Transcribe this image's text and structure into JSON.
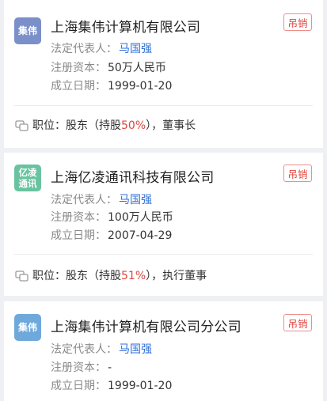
{
  "companies": [
    {
      "logo_text": "集伟",
      "logo_color": "#7b8fc9",
      "name": "上海集伟计算机有限公司",
      "status": "吊销",
      "legal_rep_label": "法定代表人：",
      "legal_rep": "马国强",
      "capital_label": "注册资本：",
      "capital": "50万人民币",
      "founded_label": "成立日期：",
      "founded": "1999-01-20",
      "position_label": "职位：",
      "position_pre": "股东（持股",
      "position_pct": "50%",
      "position_post": "），董事长"
    },
    {
      "logo_text": "亿凌通讯",
      "logo_color": "#69c3a0",
      "name": "上海亿凌通讯科技有限公司",
      "status": "吊销",
      "legal_rep_label": "法定代表人：",
      "legal_rep": "马国强",
      "capital_label": "注册资本：",
      "capital": "100万人民币",
      "founded_label": "成立日期：",
      "founded": "2007-04-29",
      "position_label": "职位：",
      "position_pre": "股东（持股",
      "position_pct": "51%",
      "position_post": "），执行董事"
    },
    {
      "logo_text": "集伟",
      "logo_color": "#6fa9dc",
      "name": "上海集伟计算机有限公司分公司",
      "status": "吊销",
      "legal_rep_label": "法定代表人：",
      "legal_rep": "马国强",
      "capital_label": "注册资本：",
      "capital": "-",
      "founded_label": "成立日期：",
      "founded": "1999-01-20"
    }
  ]
}
